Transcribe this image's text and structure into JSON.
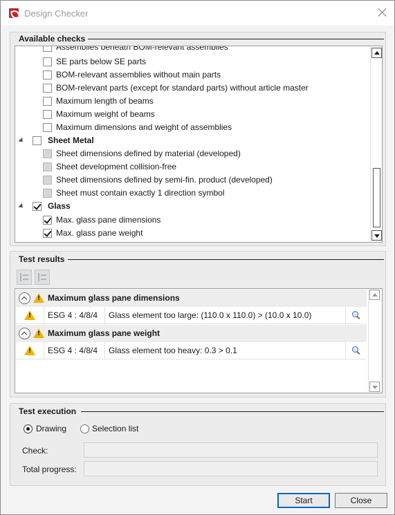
{
  "window": {
    "title": "Design Checker"
  },
  "available_checks": {
    "title": "Available checks",
    "items": [
      {
        "label": "Assemblies beneath BOM-relevant assemblies",
        "state": "unchecked"
      },
      {
        "label": "SE parts below SE parts",
        "state": "unchecked"
      },
      {
        "label": "BOM-relevant assemblies without main parts",
        "state": "unchecked"
      },
      {
        "label": "BOM-relevant parts (except for standard parts) without article master",
        "state": "unchecked"
      },
      {
        "label": "Maximum length of beams",
        "state": "unchecked"
      },
      {
        "label": "Maximum weight of beams",
        "state": "unchecked"
      },
      {
        "label": "Maximum dimensions and weight of assemblies",
        "state": "unchecked"
      },
      {
        "label": "Sheet Metal",
        "state": "unchecked",
        "group": true
      },
      {
        "label": "Sheet dimensions defined by material (developed)",
        "state": "disabled"
      },
      {
        "label": "Sheet development collision-free",
        "state": "disabled"
      },
      {
        "label": "Sheet dimensions defined by semi-fin. product (developed)",
        "state": "disabled"
      },
      {
        "label": "Sheet must contain exactly 1 direction symbol",
        "state": "disabled"
      },
      {
        "label": "Glass",
        "state": "checked",
        "group": true
      },
      {
        "label": "Max. glass pane dimensions",
        "state": "checked"
      },
      {
        "label": "Max. glass pane weight",
        "state": "checked"
      }
    ]
  },
  "test_results": {
    "title": "Test results",
    "groups": [
      {
        "title": "Maximum glass pane dimensions",
        "rows": [
          {
            "element": "ESG 4 : 4/8/4",
            "message": "Glass element too large: (110.0 x 110.0) > (10.0 x 10.0)"
          }
        ]
      },
      {
        "title": "Maximum glass pane weight",
        "rows": [
          {
            "element": "ESG 4 : 4/8/4",
            "message": "Glass element too heavy: 0.3 > 0.1"
          }
        ]
      }
    ]
  },
  "test_execution": {
    "title": "Test execution",
    "options": [
      {
        "label": "Drawing",
        "selected": true
      },
      {
        "label": "Selection list",
        "selected": false
      }
    ],
    "check_label": "Check:",
    "check_value": "",
    "progress_label": "Total progress:",
    "progress_value": ""
  },
  "buttons": {
    "start": "Start",
    "close": "Close"
  },
  "icons": {
    "app": "design-checker-app-icon",
    "close": "close-icon",
    "warning": "warning-icon",
    "zoom": "magnifier-icon",
    "collapse": "collapse-up-icon"
  }
}
